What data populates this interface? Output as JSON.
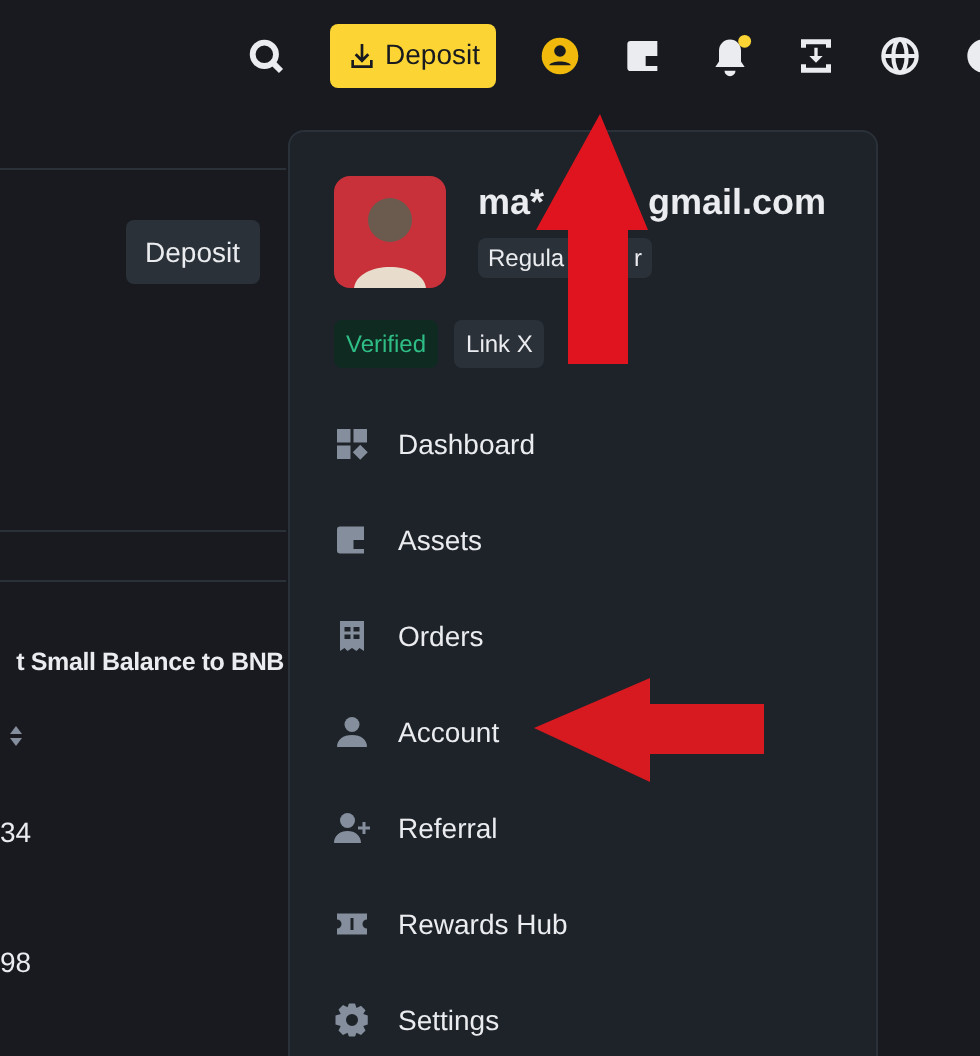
{
  "top_bar": {
    "deposit_button": "Deposit",
    "notification_dot": true
  },
  "page": {
    "deposit_button": "Deposit",
    "banner": "t Small Balance to BNB",
    "rows": [
      "34",
      "98"
    ]
  },
  "account_menu": {
    "email_parts": [
      "ma*",
      "gmail.com"
    ],
    "tier_parts": [
      "Regula",
      "r"
    ],
    "badges": [
      {
        "label": "Verified",
        "kind": "verified"
      },
      {
        "label": "Link X",
        "kind": "link"
      }
    ],
    "items": [
      {
        "label": "Dashboard",
        "kind": "dashboard"
      },
      {
        "label": "Assets",
        "kind": "wallet"
      },
      {
        "label": "Orders",
        "kind": "receipt"
      },
      {
        "label": "Account",
        "kind": "person"
      },
      {
        "label": "Referral",
        "kind": "person-plus"
      },
      {
        "label": "Rewards Hub",
        "kind": "ticket"
      },
      {
        "label": "Settings",
        "kind": "gear"
      }
    ]
  }
}
